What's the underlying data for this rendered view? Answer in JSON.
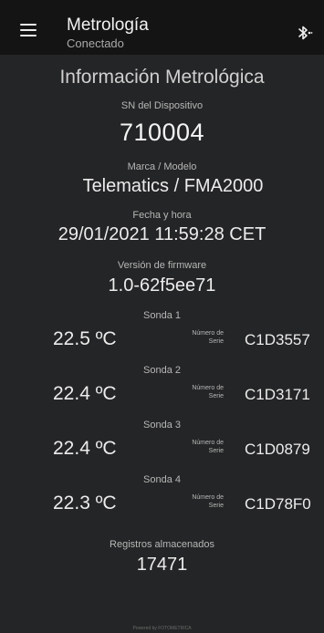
{
  "appbar": {
    "title": "Metrología",
    "subtitle": "Conectado",
    "menu_icon": "hamburger-menu-icon",
    "bluetooth_icon": "bluetooth-audio-icon"
  },
  "main": {
    "heading": "Información Metrológica",
    "serial_label": "SN del Dispositivo",
    "serial_value": "710004",
    "model_label": "Marca / Modelo",
    "model_value": "Telematics / FMA2000",
    "datetime_label": "Fecha y hora",
    "datetime_value": "29/01/2021 11:59:28 CET",
    "firmware_label": "Versión de firmware",
    "firmware_value": "1.0-62f5ee71",
    "probes": [
      {
        "label": "Sonda 1",
        "temp": "22.5 ºC",
        "serial_label": "Número de Serie",
        "serial": "C1D3557"
      },
      {
        "label": "Sonda 2",
        "temp": "22.4 ºC",
        "serial_label": "Número de Serie",
        "serial": "C1D3171"
      },
      {
        "label": "Sonda 3",
        "temp": "22.4 ºC",
        "serial_label": "Número de Serie",
        "serial": "C1D0879"
      },
      {
        "label": "Sonda 4",
        "temp": "22.3 ºC",
        "serial_label": "Número de Serie",
        "serial": "C1D78F0"
      }
    ],
    "records_label": "Registros almacenados",
    "records_value": "17471"
  },
  "footer": {
    "text": "Powered by FOTOMETRICA"
  },
  "colors": {
    "background": "#242526",
    "appbar": "#141414",
    "text_primary": "#ececec",
    "text_secondary": "#b7b7b7"
  }
}
